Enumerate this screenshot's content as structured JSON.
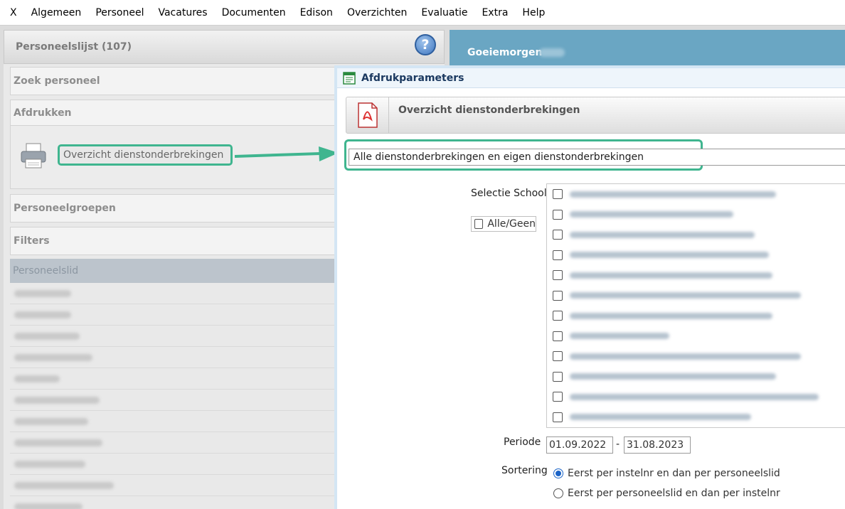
{
  "menu": [
    "X",
    "Algemeen",
    "Personeel",
    "Vacatures",
    "Documenten",
    "Edison",
    "Overzichten",
    "Evaluatie",
    "Extra",
    "Help"
  ],
  "left": {
    "header": "Personeelslijst (107)",
    "help_glyph": "?",
    "sections": {
      "zoek": "Zoek personeel",
      "afdrukken": "Afdrukken",
      "groepen": "Personeelgroepen",
      "filters": "Filters"
    },
    "print_link": "Overzicht dienstonderbrekingen",
    "list_header": "Personeelslid",
    "list_rows": 11
  },
  "right_header": {
    "greeting": "Goeiemorgen"
  },
  "dialog": {
    "title": "Afdrukparameters",
    "report_title": "Overzicht dienstonderbrekingen",
    "report_icon": "pdf-icon",
    "selection": "Alle dienstonderbrekingen en eigen dienstonderbrekingen",
    "school_label": "Selectie School",
    "alle_geen": "Alle/Geen",
    "school_count": 12,
    "periode_label": "Periode",
    "date_from": "01.09.2022",
    "date_sep": "-",
    "date_to": "31.08.2023",
    "sort_label": "Sortering",
    "sort_options": [
      "Eerst per instelnr en dan per personeelslid",
      "Eerst per personeelslid en dan per instelnr"
    ],
    "sort_selected": 0
  },
  "colors": {
    "highlight": "#3fb58f",
    "header_blue": "#6aa6c3",
    "radio_blue": "#1a63c7"
  }
}
